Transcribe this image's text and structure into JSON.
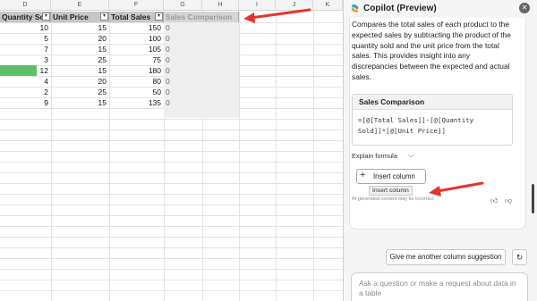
{
  "sheet": {
    "columns": [
      "D",
      "E",
      "F",
      "G",
      "H",
      "I",
      "J",
      "K"
    ],
    "headers": [
      "Quantity Sold",
      "Unit Price",
      "Total Sales",
      "Sales Comparison"
    ],
    "rows": [
      {
        "qty": "10",
        "price": "15",
        "total": "150",
        "cmp": "0"
      },
      {
        "qty": "5",
        "price": "20",
        "total": "100",
        "cmp": "0"
      },
      {
        "qty": "7",
        "price": "15",
        "total": "105",
        "cmp": "0"
      },
      {
        "qty": "3",
        "price": "25",
        "total": "75",
        "cmp": "0"
      },
      {
        "qty": "12",
        "price": "15",
        "total": "180",
        "cmp": "0"
      },
      {
        "qty": "4",
        "price": "20",
        "total": "80",
        "cmp": "0"
      },
      {
        "qty": "2",
        "price": "25",
        "total": "50",
        "cmp": "0"
      },
      {
        "qty": "9",
        "price": "15",
        "total": "135",
        "cmp": "0"
      }
    ],
    "filter_icon": "dropdown-triangle-icon",
    "highlight_color": "#5fbf68",
    "arrow_color": "#e8322c"
  },
  "copilot": {
    "title": "Copilot (Preview)",
    "description": "Compares the total sales of each product to the expected sales by subtracting the product of the quantity sold and the unit price from the total sales. This provides insight into any discrepancies between the expected and actual sales.",
    "formula_title": "Sales Comparison",
    "formula_line1": "=[@[Total Sales]]-[@[Quantity",
    "formula_line2": "Sold]]*[@[Unit Price]]",
    "explain_label": "Explain formula",
    "insert_label": "Insert column",
    "tooltip": "Insert column",
    "ai_note": "AI-generated content may be incorrect",
    "suggestion_label": "Give me another column suggestion",
    "ask_placeholder": "Ask a question or make a request about data in a table",
    "icons": {
      "logo": "copilot-logo-icon",
      "close": "close-icon",
      "chevron": "chevron-down-icon",
      "plus": "plus-icon",
      "thumbs_up": "thumbs-up-icon",
      "thumbs_down": "thumbs-down-icon",
      "refresh": "refresh-icon"
    }
  }
}
